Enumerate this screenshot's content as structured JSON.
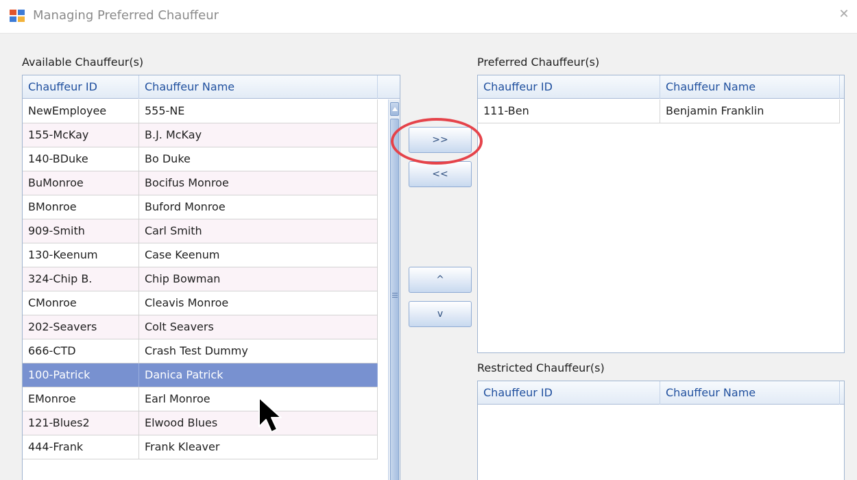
{
  "window": {
    "title": "Managing Preferred Chauffeur",
    "close_glyph": "✕",
    "icon": "app-window-icon"
  },
  "available": {
    "label": "Available Chauffeur(s)",
    "columns": [
      "Chauffeur ID",
      "Chauffeur Name"
    ],
    "rows": [
      {
        "id": "NewEmployee",
        "name": "555-NE"
      },
      {
        "id": "155-McKay",
        "name": "B.J. McKay"
      },
      {
        "id": "140-BDuke",
        "name": "Bo Duke"
      },
      {
        "id": "BuMonroe",
        "name": "Bocifus Monroe"
      },
      {
        "id": "BMonroe",
        "name": "Buford Monroe"
      },
      {
        "id": "909-Smith",
        "name": "Carl Smith"
      },
      {
        "id": "130-Keenum",
        "name": "Case Keenum"
      },
      {
        "id": "324-Chip B.",
        "name": "Chip Bowman"
      },
      {
        "id": "CMonroe",
        "name": "Cleavis Monroe"
      },
      {
        "id": "202-Seavers",
        "name": "Colt Seavers"
      },
      {
        "id": "666-CTD",
        "name": "Crash Test Dummy"
      },
      {
        "id": "100-Patrick",
        "name": "Danica Patrick"
      },
      {
        "id": "EMonroe",
        "name": "Earl Monroe"
      },
      {
        "id": "121-Blues2",
        "name": "Elwood Blues"
      },
      {
        "id": "444-Frank",
        "name": "Frank Kleaver"
      }
    ],
    "selected_index": 11
  },
  "buttons": {
    "add": ">>",
    "remove": "<<",
    "move_up": "^",
    "move_down": "v"
  },
  "preferred": {
    "label": "Preferred Chauffeur(s)",
    "columns": [
      "Chauffeur ID",
      "Chauffeur Name"
    ],
    "rows": [
      {
        "id": "111-Ben",
        "name": "Benjamin Franklin"
      }
    ]
  },
  "restricted": {
    "label": "Restricted Chauffeur(s)",
    "columns": [
      "Chauffeur ID",
      "Chauffeur Name"
    ],
    "rows": []
  },
  "colors": {
    "selection": "#7891d0",
    "header_text": "#1f4f9e",
    "highlight_ring": "#e5434a",
    "alt_row": "#fbf3f8"
  }
}
